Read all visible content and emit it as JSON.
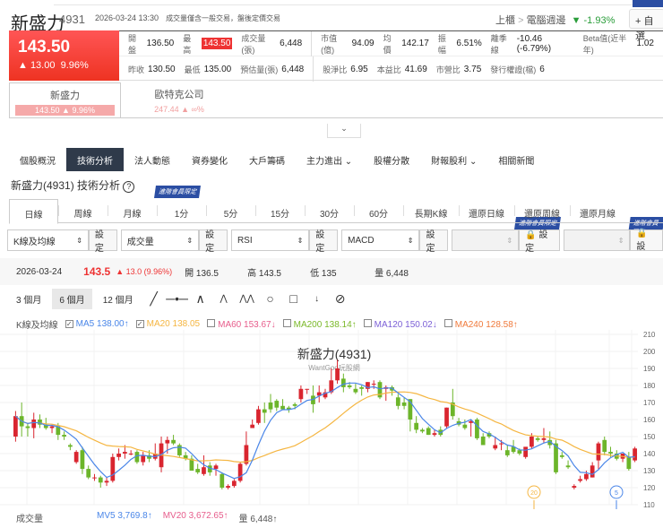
{
  "header": {
    "name": "新盛力",
    "code": "4931",
    "datetime": "2026-03-24 13:30",
    "note": "成交量僅含一般交易，盤後定價交易",
    "market": "上櫃",
    "sep": ">",
    "industry": "電腦週邊",
    "industry_change": "▼ -1.93%",
    "add_watch": "+ 自選"
  },
  "quote": {
    "price": "143.50",
    "change": "▲ 13.00",
    "pct": "9.96%"
  },
  "stats": {
    "row1": [
      [
        "開盤",
        "136.50"
      ],
      [
        "最高",
        "143.50"
      ],
      [
        "成交量(張)",
        "6,448"
      ],
      [
        "市值(億)",
        "94.09"
      ],
      [
        "均價",
        "142.17"
      ],
      [
        "振幅",
        "6.51%"
      ],
      [
        "離季線",
        "-10.46 (-6.79%)"
      ],
      [
        "Beta值(近半年)",
        "1.02"
      ]
    ],
    "row2": [
      [
        "昨收",
        "130.50"
      ],
      [
        "最低",
        "135.00"
      ],
      [
        "預估量(張)",
        "6,448"
      ],
      [
        "股淨比",
        "6.95"
      ],
      [
        "本益比",
        "41.69"
      ],
      [
        "市營比",
        "3.75"
      ],
      [
        "發行權證(檔)",
        "6"
      ]
    ]
  },
  "compare": [
    {
      "name": "新盛力",
      "quote": "143.50 ▲ 9.96%"
    },
    {
      "name": "歐特克公司",
      "quote": "247.44 ▲ ∞%"
    }
  ],
  "collapse": "⌄",
  "nav": [
    "個股概況",
    "技術分析",
    "法人動態",
    "資券變化",
    "大戶籌碼",
    "主力進出 ⌄",
    "股權分散",
    "財報股利 ⌄",
    "相關新聞"
  ],
  "section_title": "新盛力(4931) 技術分析",
  "help": "?",
  "vip_label": "進階會員限定",
  "periods": [
    "日線",
    "周線",
    "月線",
    "1分",
    "5分",
    "15分",
    "30分",
    "60分",
    "長期K線",
    "還原日線",
    "還原周線",
    "還原月線"
  ],
  "selects": [
    {
      "value": "K線及均線",
      "btn": "設定"
    },
    {
      "value": "成交量",
      "btn": "設定"
    },
    {
      "value": "RSI",
      "btn": "設定"
    },
    {
      "value": "MACD",
      "btn": "設定"
    },
    {
      "value": "",
      "btn": "🔒 設定"
    },
    {
      "value": "",
      "btn": "🔒 設"
    }
  ],
  "info": {
    "date": "2026-03-24",
    "close": "143.5",
    "change": "▲ 13.0 (9.96%)",
    "open": "開 136.5",
    "high": "高 143.5",
    "low": "低 135",
    "vol": "量 6,448"
  },
  "ranges": [
    "3 個月",
    "6 個月",
    "12 個月"
  ],
  "legend": {
    "label": "K線及均線",
    "items": [
      {
        "text": "MA5 138.00↑",
        "checked": true,
        "color": "#4a86e8"
      },
      {
        "text": "MA20 138.05",
        "checked": true,
        "color": "#f5b642"
      },
      {
        "text": "MA60 153.67↓",
        "checked": false,
        "color": "#e75d8c"
      },
      {
        "text": "MA200 138.14↑",
        "checked": false,
        "color": "#7ab828"
      },
      {
        "text": "MA120 150.02↓",
        "checked": false,
        "color": "#7b5fd6"
      },
      {
        "text": "MA240 128.58↑",
        "checked": false,
        "color": "#f07a3c"
      }
    ]
  },
  "volume": {
    "label": "成交量",
    "mv5": "MV5 3,769.8↑",
    "mv20": "MV20 3,672.65↑",
    "vol": "量 6,448↑"
  },
  "colors": {
    "up": "#d9252f",
    "down": "#6cb52a",
    "ma5": "#4a86e8",
    "ma20": "#f5b642"
  },
  "chart_data": {
    "type": "candlestick",
    "title": "新盛力(4931)",
    "watermark": "WantGoo玩股網",
    "ylim": [
      110,
      210
    ],
    "yticks": [
      110,
      120,
      130,
      140,
      150,
      160,
      170,
      180,
      190,
      200,
      210
    ],
    "markers": [
      "20",
      "5"
    ],
    "ohlc": [
      [
        150,
        165,
        147,
        162
      ],
      [
        162,
        170,
        150,
        156
      ],
      [
        156,
        158,
        150,
        155
      ],
      [
        155,
        164,
        149,
        160
      ],
      [
        160,
        163,
        155,
        157
      ],
      [
        157,
        161,
        154,
        155
      ],
      [
        155,
        157,
        152,
        156
      ],
      [
        156,
        158,
        148,
        151
      ],
      [
        151,
        153,
        148,
        150
      ],
      [
        145,
        146,
        142,
        144
      ],
      [
        135,
        142,
        134,
        141
      ],
      [
        142,
        144,
        128,
        131
      ],
      [
        131,
        133,
        125,
        126
      ],
      [
        126,
        128,
        124,
        126
      ],
      [
        126,
        127,
        120,
        123
      ],
      [
        123,
        126,
        121,
        124
      ],
      [
        124,
        140,
        123,
        138
      ],
      [
        138,
        143,
        136,
        140
      ],
      [
        140,
        145,
        137,
        141
      ],
      [
        140,
        142,
        139,
        140
      ],
      [
        141,
        142,
        134,
        135
      ],
      [
        135,
        141,
        133,
        139
      ],
      [
        139,
        142,
        135,
        137
      ],
      [
        137,
        146,
        136,
        140
      ],
      [
        132,
        150,
        129,
        146
      ],
      [
        146,
        150,
        140,
        148
      ],
      [
        148,
        151,
        145,
        146
      ],
      [
        145,
        146,
        138,
        139
      ],
      [
        139,
        141,
        136,
        137
      ],
      [
        137,
        139,
        130,
        130
      ],
      [
        131,
        134,
        128,
        129
      ],
      [
        128,
        139,
        127,
        132
      ],
      [
        133,
        135,
        127,
        129
      ],
      [
        131,
        134,
        127,
        133
      ],
      [
        128,
        129,
        119,
        120
      ],
      [
        120,
        122,
        119,
        121
      ],
      [
        121,
        125,
        120,
        124
      ],
      [
        124,
        135,
        123,
        134
      ],
      [
        134,
        153,
        133,
        145
      ],
      [
        155,
        160,
        155,
        157
      ],
      [
        158,
        168,
        157,
        166
      ],
      [
        166,
        170,
        158,
        164
      ],
      [
        170,
        175,
        164,
        166
      ],
      [
        171,
        172,
        165,
        167
      ],
      [
        168,
        172,
        166,
        166
      ],
      [
        167,
        168,
        164,
        166
      ],
      [
        169,
        170,
        166,
        168
      ],
      [
        172,
        180,
        170,
        178
      ],
      [
        178,
        178,
        175,
        178
      ],
      [
        174,
        180,
        164,
        169
      ],
      [
        174,
        180,
        170,
        176
      ],
      [
        173,
        178,
        172,
        176
      ],
      [
        176,
        190,
        175,
        183
      ],
      [
        183,
        195,
        181,
        190
      ],
      [
        184,
        187,
        176,
        179
      ],
      [
        180,
        182,
        178,
        179
      ],
      [
        178,
        181,
        175,
        176
      ],
      [
        179,
        180,
        174,
        178
      ],
      [
        178,
        182,
        176,
        182
      ],
      [
        181,
        183,
        178,
        181
      ],
      [
        182,
        183,
        172,
        173
      ],
      [
        178,
        180,
        171,
        179
      ],
      [
        179,
        180,
        174,
        177
      ],
      [
        173,
        175,
        166,
        168
      ],
      [
        170,
        173,
        166,
        168
      ],
      [
        172,
        172,
        153,
        160
      ],
      [
        158,
        162,
        152,
        154
      ],
      [
        154,
        155,
        152,
        153
      ],
      [
        155,
        156,
        151,
        151
      ],
      [
        151,
        154,
        150,
        152
      ],
      [
        154,
        156,
        150,
        151
      ],
      [
        156,
        167,
        155,
        167
      ],
      [
        170,
        178,
        160,
        162
      ],
      [
        159,
        161,
        156,
        157
      ],
      [
        157,
        160,
        154,
        155
      ],
      [
        158,
        160,
        150,
        159
      ],
      [
        160,
        161,
        148,
        149
      ],
      [
        150,
        152,
        145,
        145
      ],
      [
        152,
        153,
        149,
        150
      ],
      [
        143,
        150,
        142,
        145
      ],
      [
        146,
        148,
        142,
        146
      ],
      [
        142,
        145,
        138,
        139
      ],
      [
        144,
        148,
        140,
        141
      ],
      [
        142,
        143,
        139,
        140
      ],
      [
        138,
        143,
        137,
        144
      ],
      [
        144,
        152,
        143,
        150
      ],
      [
        149,
        150,
        147,
        148
      ],
      [
        148,
        155,
        146,
        149
      ],
      [
        148,
        153,
        143,
        145
      ],
      [
        146,
        148,
        128,
        129
      ],
      [
        139,
        141,
        137,
        138
      ],
      [
        133,
        136,
        131,
        132
      ],
      [
        120,
        122,
        119,
        121
      ],
      [
        124,
        127,
        123,
        125
      ],
      [
        125,
        130,
        124,
        128
      ],
      [
        126,
        135,
        126,
        133
      ],
      [
        136,
        147,
        131,
        146
      ],
      [
        148,
        150,
        139,
        141
      ],
      [
        141,
        144,
        138,
        140
      ],
      [
        140,
        142,
        136,
        137
      ],
      [
        137,
        140,
        135,
        140
      ],
      [
        138,
        141,
        130,
        131
      ],
      [
        136,
        144,
        135,
        143
      ]
    ]
  }
}
